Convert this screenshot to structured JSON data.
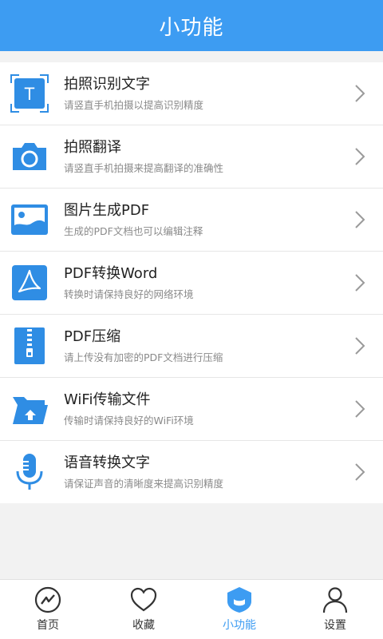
{
  "header": {
    "title": "小功能"
  },
  "colors": {
    "accent": "#3d9cf2",
    "icon_blue": "#2f8de4",
    "chevron": "#9a9a9a"
  },
  "features": [
    {
      "title": "拍照识别文字",
      "subtitle": "请竖直手机拍摄以提高识别精度",
      "icon": "scan-text-icon"
    },
    {
      "title": "拍照翻译",
      "subtitle": "请竖直手机拍摄来提高翻译的准确性",
      "icon": "camera-icon"
    },
    {
      "title": "图片生成PDF",
      "subtitle": "生成的PDF文档也可以编辑注释",
      "icon": "image-icon"
    },
    {
      "title": "PDF转换Word",
      "subtitle": "转换时请保持良好的网络环境",
      "icon": "pdf-icon"
    },
    {
      "title": "PDF压缩",
      "subtitle": "请上传没有加密的PDF文档进行压缩",
      "icon": "zip-icon"
    },
    {
      "title": "WiFi传输文件",
      "subtitle": "传输时请保持良好的WiFi环境",
      "icon": "folder-upload-icon"
    },
    {
      "title": "语音转换文字",
      "subtitle": "请保证声音的清晰度来提高识别精度",
      "icon": "microphone-icon"
    }
  ],
  "tabs": [
    {
      "label": "首页",
      "icon": "home-activity-icon",
      "active": false
    },
    {
      "label": "收藏",
      "icon": "heart-icon",
      "active": false
    },
    {
      "label": "小功能",
      "icon": "shield-icon",
      "active": true
    },
    {
      "label": "设置",
      "icon": "user-icon",
      "active": false
    }
  ]
}
